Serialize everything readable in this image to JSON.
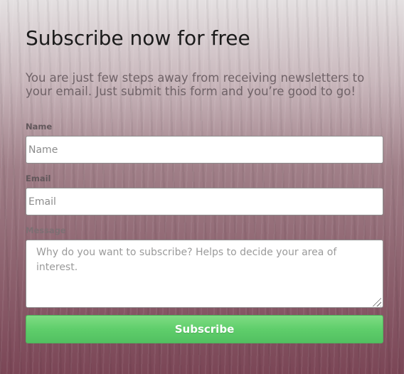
{
  "form": {
    "title": "Subscribe now for free",
    "subtitle": "You are just few steps away from receiving newsletters to your email. Just submit this form and you’re good to go!",
    "name": {
      "label": "Name",
      "placeholder": "Name",
      "value": ""
    },
    "email": {
      "label": "Email",
      "placeholder": "Email",
      "value": ""
    },
    "message": {
      "label": "Message",
      "placeholder": "Why do you want to subscribe? Helps to decide your area of interest.",
      "value": ""
    },
    "submit_label": "Subscribe"
  },
  "colors": {
    "button": "#5fce6b",
    "title": "#1b1b1b",
    "subtitle": "#6f6267"
  }
}
